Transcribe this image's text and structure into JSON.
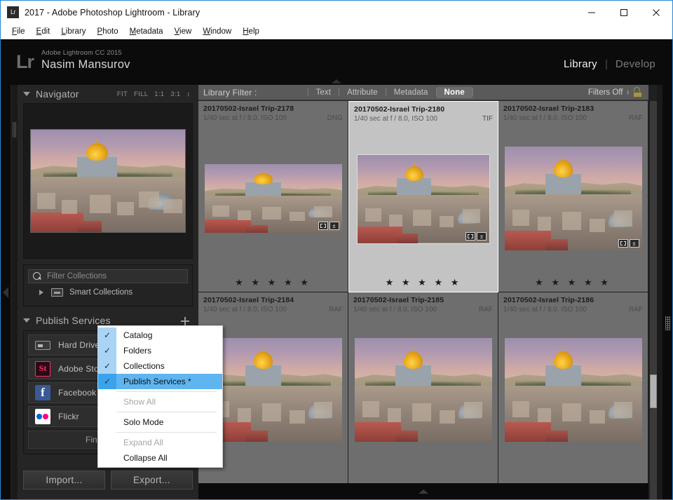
{
  "window": {
    "title": "2017 - Adobe Photoshop Lightroom - Library",
    "app_icon": "Lr",
    "controls": {
      "minimize": "minimize-icon",
      "maximize": "maximize-icon",
      "close": "close-icon"
    }
  },
  "menubar": [
    {
      "label": "File",
      "accel": "F"
    },
    {
      "label": "Edit",
      "accel": "E"
    },
    {
      "label": "Library",
      "accel": "L"
    },
    {
      "label": "Photo",
      "accel": "P"
    },
    {
      "label": "Metadata",
      "accel": "M"
    },
    {
      "label": "View",
      "accel": "V"
    },
    {
      "label": "Window",
      "accel": "W"
    },
    {
      "label": "Help",
      "accel": "H"
    }
  ],
  "identity": {
    "logo": "Lr",
    "product": "Adobe Lightroom CC 2015",
    "user": "Nasim Mansurov"
  },
  "modules": [
    {
      "label": "Library",
      "active": true
    },
    {
      "label": "Develop",
      "active": false
    }
  ],
  "module_separator": "|",
  "navigator": {
    "title": "Navigator",
    "modes": [
      "FIT",
      "FILL",
      "1:1",
      "3:1"
    ],
    "stepper": "↕"
  },
  "collections": {
    "filter_placeholder": "Filter Collections",
    "smart_collections_label": "Smart Collections"
  },
  "publish_services": {
    "title": "Publish Services",
    "add_label": "plus-icon",
    "items": [
      {
        "label": "Hard Drive",
        "icon": "hard-drive-icon"
      },
      {
        "label": "Adobe Stock",
        "icon": "adobe-stock-icon",
        "glyph": "St"
      },
      {
        "label": "Facebook",
        "icon": "facebook-icon",
        "glyph": "f"
      },
      {
        "label": "Flickr",
        "icon": "flickr-icon"
      }
    ],
    "find_more_label": "Find More..."
  },
  "bottom_buttons": {
    "import": "Import...",
    "export": "Export..."
  },
  "library_filter": {
    "title": "Library Filter :",
    "tabs": [
      {
        "label": "Text",
        "active": false
      },
      {
        "label": "Attribute",
        "active": false
      },
      {
        "label": "Metadata",
        "active": false
      },
      {
        "label": "None",
        "active": true
      }
    ],
    "filters_state": "Filters Off",
    "stepper": "↕",
    "lock_icon": "lock-open-icon"
  },
  "grid": {
    "rows": [
      [
        {
          "name": "20170502-Israel Trip-2178",
          "exif": "1/40 sec at f / 8.0, ISO 100",
          "format": "DNG",
          "rating": "★ ★ ★ ★ ★",
          "rating_dim": false,
          "selected": false,
          "badges": [
            "crop-badge",
            "develop-badge"
          ],
          "thumb_w": 196,
          "thumb_h": 98
        },
        {
          "name": "20170502-Israel Trip-2180",
          "exif": "1/40 sec at f / 8.0, ISO 100",
          "format": "TIF",
          "rating": "★ ★ ★ ★ ★",
          "rating_dim": false,
          "selected": true,
          "badges": [
            "crop-badge",
            "develop-badge"
          ],
          "thumb_w": 190,
          "thumb_h": 128
        },
        {
          "name": "20170502-Israel Trip-2183",
          "exif": "1/40 sec at f / 8.0, ISO 100",
          "format": "RAF",
          "rating": "★ ★ ★ ★ ★",
          "rating_dim": false,
          "selected": false,
          "badges": [
            "crop-badge",
            "develop-badge"
          ],
          "thumb_w": 196,
          "thumb_h": 148
        }
      ],
      [
        {
          "name": "20170502-Israel Trip-2184",
          "exif": "1/40 sec at f / 8.0, ISO 100",
          "format": "RAF",
          "rating": "· · · · ·",
          "rating_dim": true,
          "selected": false,
          "badges": [],
          "thumb_w": 196,
          "thumb_h": 148
        },
        {
          "name": "20170502-Israel Trip-2185",
          "exif": "1/40 sec at f / 8.0, ISO 100",
          "format": "RAF",
          "rating": "· · · · ·",
          "rating_dim": true,
          "selected": false,
          "badges": [],
          "thumb_w": 196,
          "thumb_h": 148
        },
        {
          "name": "20170502-Israel Trip-2186",
          "exif": "1/40 sec at f / 8.0, ISO 100",
          "format": "RAF",
          "rating": "· · · · ·",
          "rating_dim": true,
          "selected": false,
          "badges": [],
          "thumb_w": 196,
          "thumb_h": 148
        }
      ]
    ]
  },
  "context_menu": {
    "items": [
      {
        "label": "Catalog",
        "checked": true,
        "highlight": false,
        "disabled": false
      },
      {
        "label": "Folders",
        "checked": true,
        "highlight": false,
        "disabled": false
      },
      {
        "label": "Collections",
        "checked": true,
        "highlight": false,
        "disabled": false
      },
      {
        "label": "Publish Services *",
        "checked": true,
        "highlight": true,
        "disabled": false
      },
      {
        "separator": true
      },
      {
        "label": "Show All",
        "checked": false,
        "highlight": false,
        "disabled": true
      },
      {
        "separator": true
      },
      {
        "label": "Solo Mode",
        "checked": false,
        "highlight": false,
        "disabled": false
      },
      {
        "separator": true
      },
      {
        "label": "Expand All",
        "checked": false,
        "highlight": false,
        "disabled": true
      },
      {
        "label": "Collapse All",
        "checked": false,
        "highlight": false,
        "disabled": false
      }
    ],
    "check_glyph": "✓"
  },
  "colors": {
    "accent_blue": "#5fb5f0",
    "window_border": "#2b87d8",
    "panel_bg": "#252525",
    "grid_bg": "#2b2b2b",
    "cell_bg": "#6e6e6e",
    "cell_selected_bg": "#c3c3c3",
    "filter_bar_bg": "#5a5a5a"
  }
}
